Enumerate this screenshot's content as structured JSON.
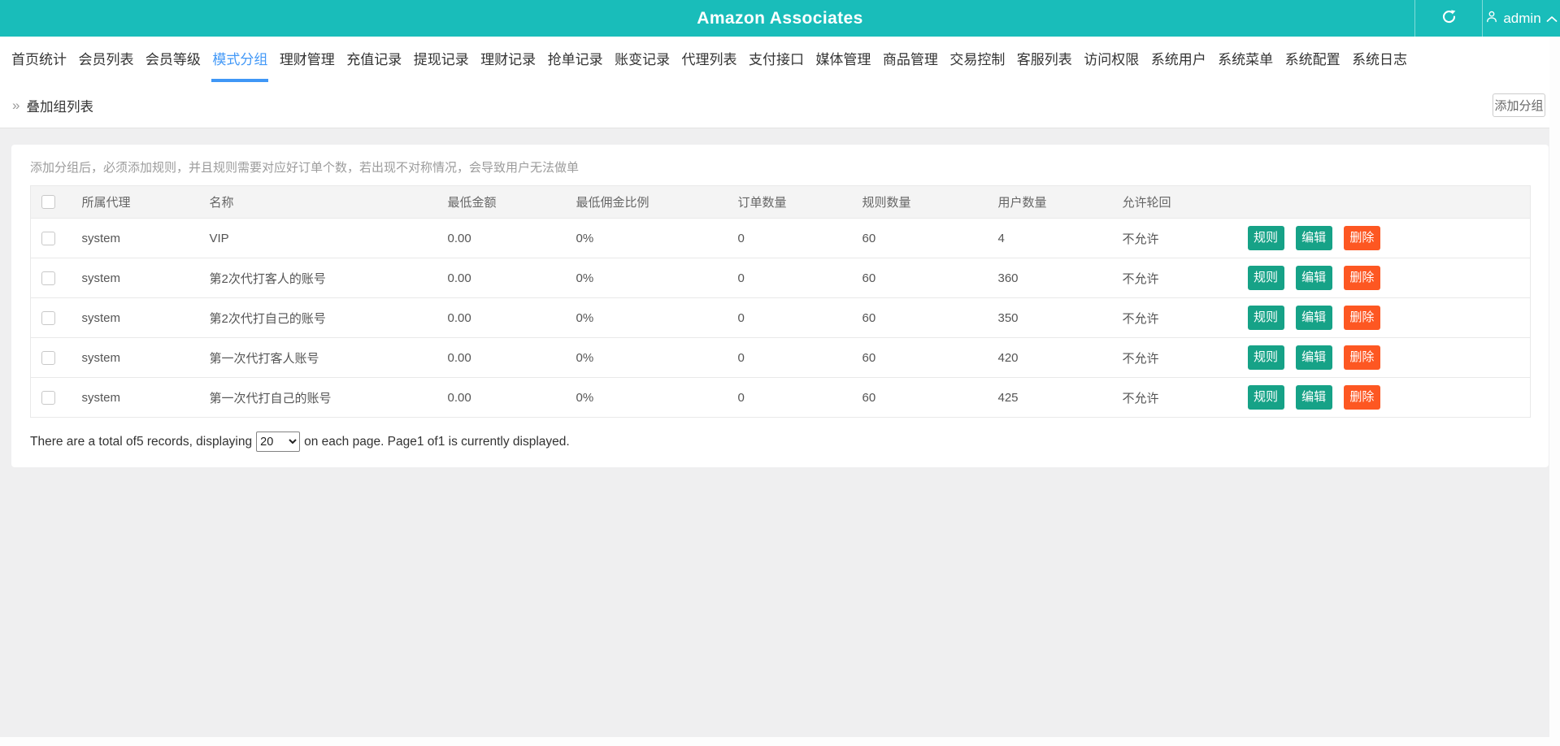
{
  "colors": {
    "header_bg": "#19bdba",
    "nav_active_blue": "#4298f7",
    "action_button_teal": "#16a287",
    "action_button_orange": "#fd5722"
  },
  "header": {
    "title": "Amazon Associates",
    "username": "admin"
  },
  "nav": {
    "items": [
      "首页统计",
      "会员列表",
      "会员等级",
      "模式分组",
      "理财管理",
      "充值记录",
      "提现记录",
      "理财记录",
      "抢单记录",
      "账变记录",
      "代理列表",
      "支付接口",
      "媒体管理",
      "商品管理",
      "交易控制",
      "客服列表",
      "访问权限",
      "系统用户",
      "系统菜单",
      "系统配置",
      "系统日志"
    ],
    "active_item": "模式分组"
  },
  "toolbar": {
    "breadcrumb_arrows": "»",
    "breadcrumb": "叠加组列表",
    "add_group_label": "添加分组"
  },
  "content": {
    "notice": "添加分组后，必须添加规则，并且规则需要对应好订单个数，若出现不对称情况，会导致用户无法做单",
    "table": {
      "headers": {
        "agent": "所属代理",
        "name": "名称",
        "min_amount": "最低金额",
        "min_commission": "最低佣金比例",
        "order_count": "订单数量",
        "rule_count": "规则数量",
        "user_count": "用户数量",
        "allow_loop": "允许轮回"
      },
      "action_labels": {
        "rule": "规则",
        "edit": "编辑",
        "delete": "删除"
      },
      "rows": [
        {
          "agent": "system",
          "name": "VIP",
          "min_amount": "0.00",
          "min_commission": "0%",
          "order_count": "0",
          "rule_count": "60",
          "user_count": "4",
          "allow_loop": "不允许"
        },
        {
          "agent": "system",
          "name": "第2次代打客人的账号",
          "min_amount": "0.00",
          "min_commission": "0%",
          "order_count": "0",
          "rule_count": "60",
          "user_count": "360",
          "allow_loop": "不允许"
        },
        {
          "agent": "system",
          "name": "第2次代打自己的账号",
          "min_amount": "0.00",
          "min_commission": "0%",
          "order_count": "0",
          "rule_count": "60",
          "user_count": "350",
          "allow_loop": "不允许"
        },
        {
          "agent": "system",
          "name": "第一次代打客人账号",
          "min_amount": "0.00",
          "min_commission": "0%",
          "order_count": "0",
          "rule_count": "60",
          "user_count": "420",
          "allow_loop": "不允许"
        },
        {
          "agent": "system",
          "name": "第一次代打自己的账号",
          "min_amount": "0.00",
          "min_commission": "0%",
          "order_count": "0",
          "rule_count": "60",
          "user_count": "425",
          "allow_loop": "不允许"
        }
      ]
    },
    "pagination": {
      "text_before_select": "There are a total of5 records, displaying",
      "page_size": "20",
      "text_after_select": "on each page. Page1 of1 is currently displayed."
    }
  }
}
